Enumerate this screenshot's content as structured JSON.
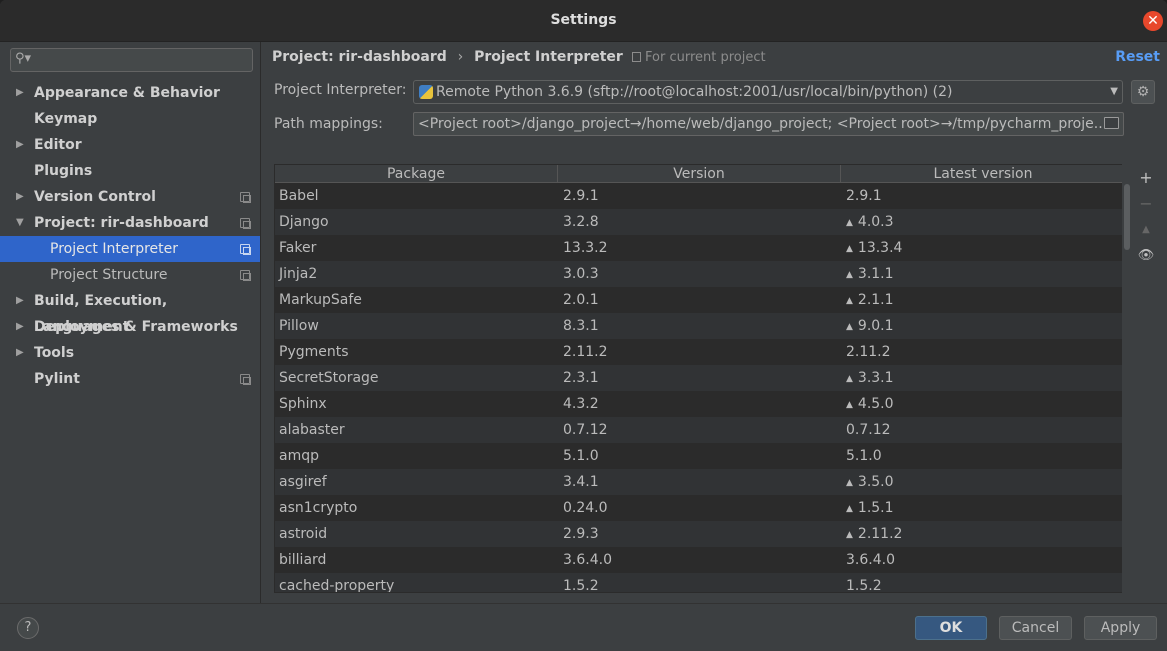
{
  "window": {
    "title": "Settings"
  },
  "search": {
    "placeholder": "",
    "value": ""
  },
  "sidebar": {
    "items": [
      {
        "label": "Appearance & Behavior",
        "expandable": true,
        "expanded": false
      },
      {
        "label": "Keymap",
        "expandable": false
      },
      {
        "label": "Editor",
        "expandable": true,
        "expanded": false
      },
      {
        "label": "Plugins",
        "expandable": false
      },
      {
        "label": "Version Control",
        "expandable": true,
        "expanded": false,
        "project_scope": true
      },
      {
        "label": "Project: rir-dashboard",
        "expandable": true,
        "expanded": true,
        "project_scope": true
      },
      {
        "label": "Project Interpreter",
        "child": true,
        "selected": true,
        "project_scope": true
      },
      {
        "label": "Project Structure",
        "child": true,
        "project_scope": true
      },
      {
        "label": "Build, Execution, Deployment",
        "expandable": true,
        "expanded": false
      },
      {
        "label": "Languages & Frameworks",
        "expandable": true,
        "expanded": false
      },
      {
        "label": "Tools",
        "expandable": true,
        "expanded": false
      },
      {
        "label": "Pylint",
        "expandable": false,
        "project_scope": true
      }
    ]
  },
  "header": {
    "breadcrumb_parent": "Project: rir-dashboard",
    "breadcrumb_sep": "›",
    "breadcrumb_current": "Project Interpreter",
    "scope_label": "For current project",
    "reset_label": "Reset"
  },
  "interpreter": {
    "label": "Project Interpreter:",
    "value": "Remote Python 3.6.9 (sftp://root@localhost:2001/usr/local/bin/python) (2)"
  },
  "path_mappings": {
    "label": "Path mappings:",
    "value": "<Project root>/django_project→/home/web/django_project; <Project root>→/tmp/pycharm_proje..."
  },
  "table": {
    "columns": [
      "Package",
      "Version",
      "Latest version"
    ],
    "rows": [
      {
        "package": "Babel",
        "version": "2.9.1",
        "latest": "2.9.1",
        "upgrade": false
      },
      {
        "package": "Django",
        "version": "3.2.8",
        "latest": "4.0.3",
        "upgrade": true
      },
      {
        "package": "Faker",
        "version": "13.3.2",
        "latest": "13.3.4",
        "upgrade": true
      },
      {
        "package": "Jinja2",
        "version": "3.0.3",
        "latest": "3.1.1",
        "upgrade": true
      },
      {
        "package": "MarkupSafe",
        "version": "2.0.1",
        "latest": "2.1.1",
        "upgrade": true
      },
      {
        "package": "Pillow",
        "version": "8.3.1",
        "latest": "9.0.1",
        "upgrade": true
      },
      {
        "package": "Pygments",
        "version": "2.11.2",
        "latest": "2.11.2",
        "upgrade": false
      },
      {
        "package": "SecretStorage",
        "version": "2.3.1",
        "latest": "3.3.1",
        "upgrade": true
      },
      {
        "package": "Sphinx",
        "version": "4.3.2",
        "latest": "4.5.0",
        "upgrade": true
      },
      {
        "package": "alabaster",
        "version": "0.7.12",
        "latest": "0.7.12",
        "upgrade": false
      },
      {
        "package": "amqp",
        "version": "5.1.0",
        "latest": "5.1.0",
        "upgrade": false
      },
      {
        "package": "asgiref",
        "version": "3.4.1",
        "latest": "3.5.0",
        "upgrade": true
      },
      {
        "package": "asn1crypto",
        "version": "0.24.0",
        "latest": "1.5.1",
        "upgrade": true
      },
      {
        "package": "astroid",
        "version": "2.9.3",
        "latest": "2.11.2",
        "upgrade": true
      },
      {
        "package": "billiard",
        "version": "3.6.4.0",
        "latest": "3.6.4.0",
        "upgrade": false
      },
      {
        "package": "cached-property",
        "version": "1.5.2",
        "latest": "1.5.2",
        "upgrade": false
      }
    ]
  },
  "tools": {
    "add": "+",
    "remove": "−",
    "upgrade": "▲",
    "show_early": "👁"
  },
  "footer": {
    "help_label": "?",
    "ok_label": "OK",
    "cancel_label": "Cancel",
    "apply_label": "Apply"
  },
  "colors": {
    "selection": "#2f65ca",
    "accent_link": "#589df6",
    "ok_button": "#365880",
    "close_button": "#e8482c"
  }
}
